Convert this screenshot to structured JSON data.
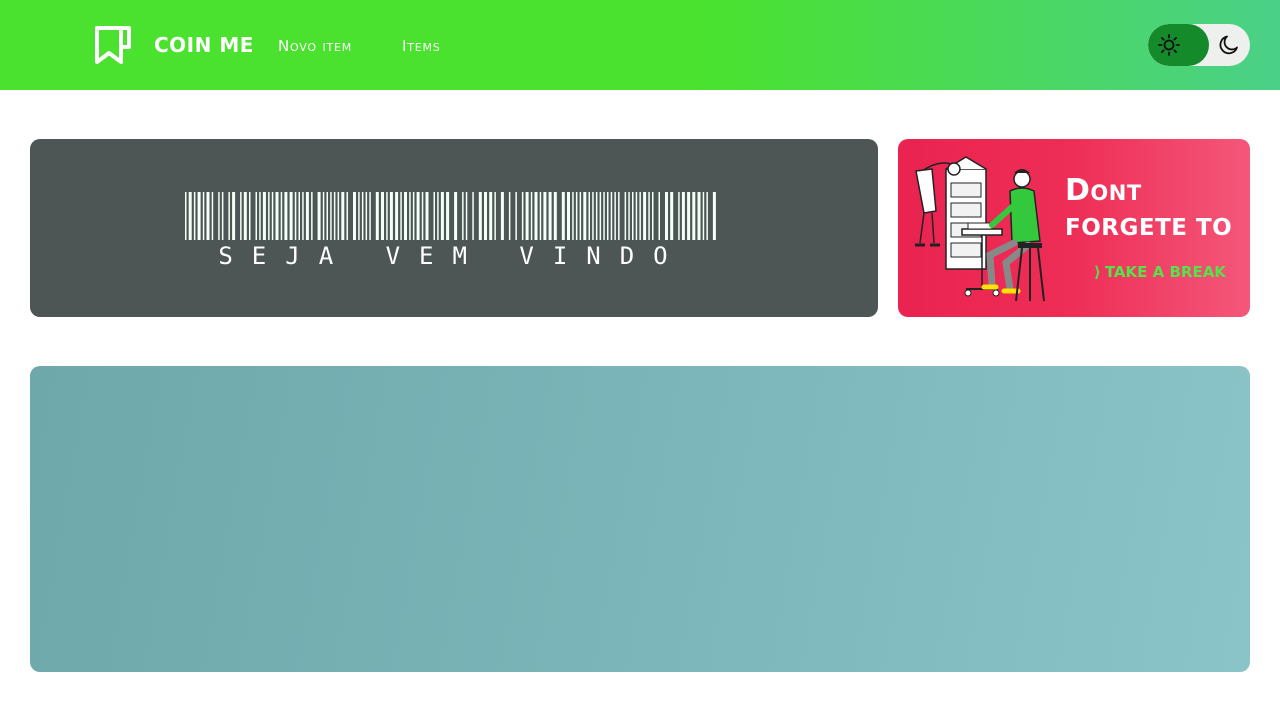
{
  "navbar": {
    "brand": "COIN ME",
    "logo_icon": "bookmark-icon",
    "links": [
      "Novo item",
      "Items"
    ],
    "theme_toggle": {
      "active": "light",
      "icons": [
        "sun-icon",
        "moon-icon"
      ]
    },
    "colors": {
      "gradient_start": "#4ae22f",
      "gradient_end": "#4bd088",
      "toggle_knob": "#148a2b"
    }
  },
  "welcome_banner": {
    "text": "SEJA VEM VINDO",
    "graphic": "barcode",
    "background": "#4d5555"
  },
  "reminder_card": {
    "title": "Dont",
    "subtitle": "FORGETE TO",
    "link": "TAKE A BREAK",
    "link_icon": "chevron-right-icon",
    "illustration": "office-workers-illustration",
    "background_start": "#ea2350",
    "background_end": "#f4577a",
    "link_color": "#55e24a"
  },
  "main_panel": {
    "background_start": "#6ea8aa",
    "background_end": "#8bc4c8"
  }
}
